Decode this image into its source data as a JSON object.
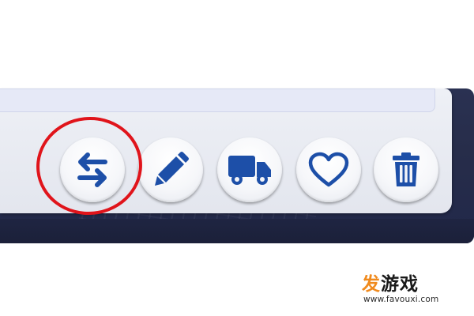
{
  "colors": {
    "icon_blue": "#1d4fa8",
    "highlight_red": "#e0141b",
    "watermark_orange": "#f08a1d"
  },
  "toolbar": {
    "name_field": {
      "value": "",
      "placeholder": ""
    },
    "buttons": [
      {
        "id": "swap",
        "icon": "swap-arrows-icon"
      },
      {
        "id": "edit",
        "icon": "pencil-icon"
      },
      {
        "id": "move",
        "icon": "truck-icon"
      },
      {
        "id": "favorite",
        "icon": "heart-icon"
      },
      {
        "id": "delete",
        "icon": "trash-icon"
      }
    ],
    "highlighted_button": "swap"
  },
  "watermark": {
    "logo_char1": "发",
    "logo_rest": "游戏",
    "url": "www.favouxi.com"
  }
}
